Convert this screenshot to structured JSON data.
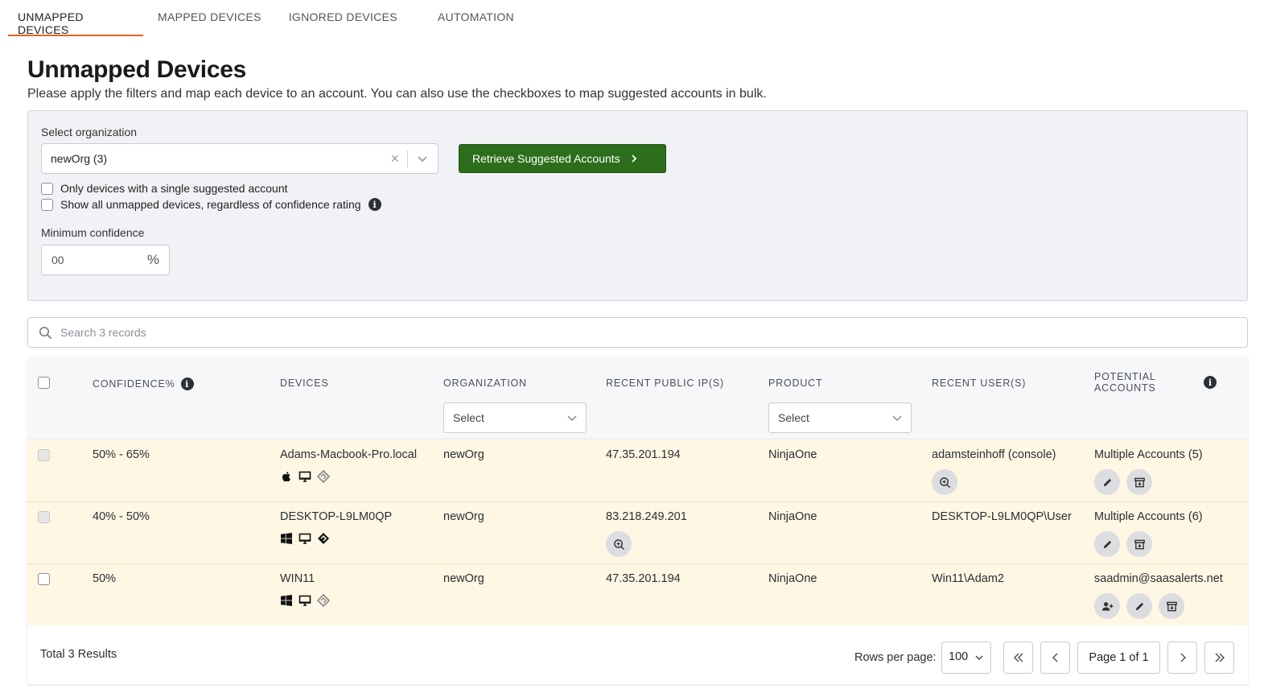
{
  "tabs": [
    {
      "label": "UNMAPPED DEVICES"
    },
    {
      "label": "MAPPED DEVICES"
    },
    {
      "label": "IGNORED DEVICES"
    },
    {
      "label": "AUTOMATION"
    }
  ],
  "page": {
    "title": "Unmapped Devices",
    "subtitle": "Please apply the filters and map each device to an account. You can also use the checkboxes to map suggested accounts in bulk."
  },
  "filters": {
    "org_label": "Select organization",
    "org_value": "newOrg (3)",
    "clear_symbol": "×",
    "retrieve_label": "Retrieve Suggested Accounts",
    "single_suggested_label": "Only devices with a single suggested account",
    "show_all_label": "Show all unmapped devices, regardless of confidence rating",
    "min_conf_label": "Minimum confidence",
    "min_conf_value": "00",
    "pct_symbol": "%"
  },
  "search": {
    "placeholder": "Search 3 records"
  },
  "table": {
    "headers": {
      "confidence": "CONFIDENCE%",
      "devices": "DEVICES",
      "organization": "ORGANIZATION",
      "ip": "RECENT PUBLIC IP(S)",
      "product": "PRODUCT",
      "users": "RECENT USER(S)",
      "accounts_line1": "POTENTIAL",
      "accounts_line2": "ACCOUNTS"
    },
    "org_select": "Select",
    "product_select": "Select",
    "rows": [
      {
        "confidence": "50% - 65%",
        "device": "Adams-Macbook-Pro.local",
        "organization": "newOrg",
        "ip": "47.35.201.194",
        "product": "NinjaOne",
        "user": "adamsteinhoff (console)",
        "account": "Multiple Accounts (5)",
        "os": "apple"
      },
      {
        "confidence": "40% - 50%",
        "device": "DESKTOP-L9LM0QP",
        "organization": "newOrg",
        "ip": "83.218.249.201",
        "product": "NinjaOne",
        "user": "DESKTOP-L9LM0QP\\User",
        "account": "Multiple Accounts (6)",
        "os": "windows"
      },
      {
        "confidence": "50%",
        "device": "WIN11",
        "organization": "newOrg",
        "ip": "47.35.201.194",
        "product": "NinjaOne",
        "user": "Win11\\Adam2",
        "account": "saadmin@saasalerts.net",
        "os": "windows"
      }
    ],
    "footer": {
      "total": "Total 3 Results",
      "rows_per_page_label": "Rows per page:",
      "rows_per_page_value": "100",
      "page_label": "Page 1 of 1"
    }
  },
  "colors": {
    "accent_tab": "#e0641e",
    "primary_button": "#2c6e1b",
    "row_bg": "#fdf7e3"
  }
}
